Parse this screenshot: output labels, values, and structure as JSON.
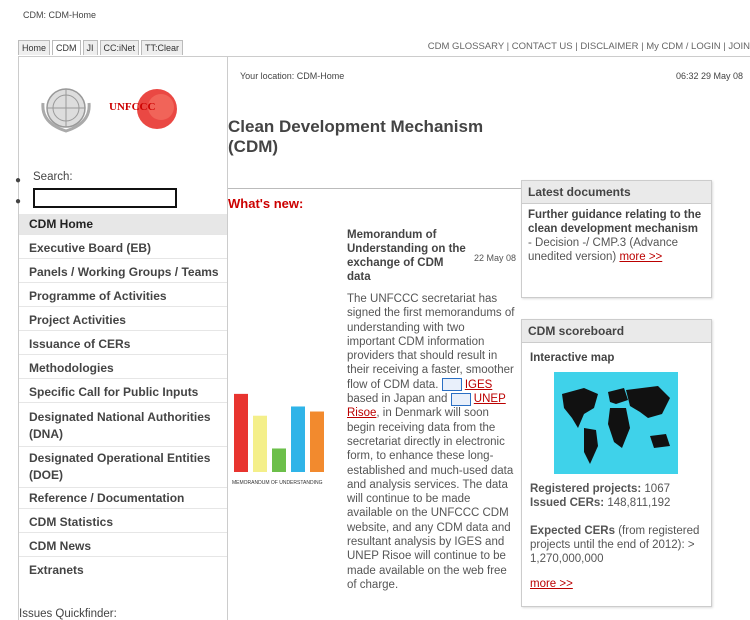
{
  "window_title": "CDM: CDM-Home",
  "tabs": [
    "Home",
    "CDM",
    "JI",
    "CC:iNet",
    "TT:Clear"
  ],
  "top_links": [
    "CDM GLOSSARY",
    "CONTACT US",
    "DISCLAIMER",
    "My CDM / LOGIN",
    "JOIN"
  ],
  "search": {
    "label": "Search:",
    "value": ""
  },
  "nav": [
    "CDM Home",
    "Executive Board (EB)",
    "Panels / Working Groups / Teams",
    "Programme of Activities",
    "Project Activities",
    "Issuance of CERs",
    "Methodologies",
    "Specific Call for Public Inputs",
    "Designated National Authorities (DNA)",
    "Designated Operational Entities (DOE)",
    "Reference / Documentation",
    "CDM Statistics",
    "CDM News",
    "Extranets"
  ],
  "issues_quickfinder": "Issues Quickfinder:",
  "location": "Your location: CDM-Home",
  "timestamp": "06:32 29 May 08",
  "page_title": "Clean Development Mechanism (CDM)",
  "whats_new": "What's new:",
  "news": {
    "title": "Memorandum of Understanding on the exchange of CDM data",
    "date": "22 May 08",
    "image_caption": "MEMORANDUM OF UNDERSTANDING",
    "bar_colors": [
      "#e8342f",
      "#f4ef8a",
      "#6cbf4a",
      "#2fb4e8",
      "#f28a2e"
    ],
    "bar_levels": [
      0.93,
      0.67,
      0.28,
      0.78,
      0.72
    ],
    "p1": "The UNFCCC secretariat has signed the first memorandums of understanding with two important CDM information providers that should result in their receiving a faster, smoother flow of CDM data.",
    "igis": "IGES",
    "igis_tail": "based in Japan and",
    "unep": "UNEP Risoe",
    "p2": ", in Denmark will soon begin receiving data from the secretariat directly in electronic form, to enhance these long-established and much-used data and analysis services. The data will continue to be made available on the UNFCCC CDM website, and any CDM data and resultant analysis by IGES and UNEP Risoe will continue to be made available on the web free of charge."
  },
  "latest_docs": {
    "head": "Latest documents",
    "title": "Further guidance relating to the clean development mechanism",
    "rest": " - Decision -/ CMP.3 (Advance unedited version)",
    "more": "more >>"
  },
  "scoreboard": {
    "head": "CDM scoreboard",
    "map_label": "Interactive map",
    "registered_label": "Registered projects:",
    "registered_value": "1067",
    "issued_label": "Issued CERs:",
    "issued_value": "148,811,192",
    "expected_label": "Expected CERs",
    "expected_text": " (from registered projects until the end of 2012): > 1,270,000,000",
    "more": "more >>"
  },
  "logo_text": "UNFCCC",
  "colors": {
    "accent_red": "#cc0000",
    "map_bg": "#3fd2ea"
  }
}
